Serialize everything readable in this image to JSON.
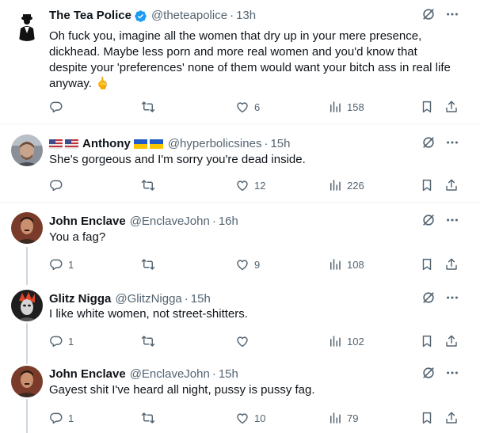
{
  "tweets": [
    {
      "name": "The Tea Police",
      "handle": "@theteapolice",
      "time": "13h",
      "text": "Oh fuck you, imagine all the women that dry up in your mere presence, dickhead. Maybe less porn and more real women and you'd know that despite your 'preferences' none of them would want your bitch ass in real life anyway. 🖕",
      "reply": "",
      "repost": "",
      "like": "6",
      "views": "158",
      "verified": true
    },
    {
      "name": "Anthony",
      "handle": "@hyperbolicsines",
      "time": "15h",
      "text": "She's gorgeous and I'm sorry you're dead inside.",
      "reply": "",
      "repost": "",
      "like": "12",
      "views": "226"
    },
    {
      "name": "John Enclave",
      "handle": "@EnclaveJohn",
      "time": "16h",
      "text": "You a fag?",
      "reply": "1",
      "repost": "",
      "like": "9",
      "views": "108"
    },
    {
      "name": "Glitz Nigga",
      "handle": "@GlitzNigga",
      "time": "15h",
      "text": "I like white women, not street-shitters.",
      "reply": "1",
      "repost": "",
      "like": "",
      "views": "102"
    },
    {
      "name": "John Enclave",
      "handle": "@EnclaveJohn",
      "time": "15h",
      "text": "Gayest shit I've heard all night, pussy is pussy fag.",
      "reply": "1",
      "repost": "",
      "like": "10",
      "views": "79"
    }
  ],
  "separator": "·",
  "colors": {
    "text": "#0f1419",
    "muted": "#536471",
    "verified": "#1d9bf0",
    "divider": "#eff3f4",
    "thread": "#cfd9de"
  }
}
